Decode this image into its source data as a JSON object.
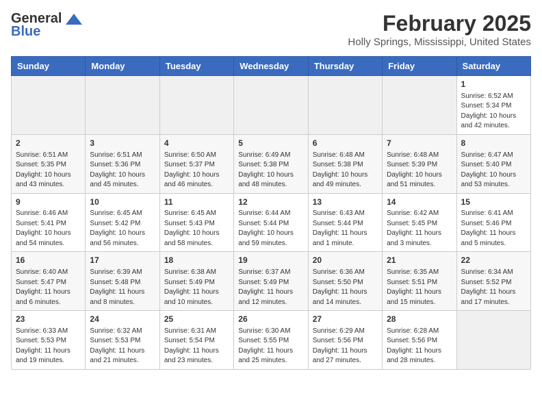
{
  "header": {
    "logo_line1": "General",
    "logo_line2": "Blue",
    "month_year": "February 2025",
    "location": "Holly Springs, Mississippi, United States"
  },
  "weekdays": [
    "Sunday",
    "Monday",
    "Tuesday",
    "Wednesday",
    "Thursday",
    "Friday",
    "Saturday"
  ],
  "weeks": [
    [
      {
        "day": "",
        "info": ""
      },
      {
        "day": "",
        "info": ""
      },
      {
        "day": "",
        "info": ""
      },
      {
        "day": "",
        "info": ""
      },
      {
        "day": "",
        "info": ""
      },
      {
        "day": "",
        "info": ""
      },
      {
        "day": "1",
        "info": "Sunrise: 6:52 AM\nSunset: 5:34 PM\nDaylight: 10 hours and 42 minutes."
      }
    ],
    [
      {
        "day": "2",
        "info": "Sunrise: 6:51 AM\nSunset: 5:35 PM\nDaylight: 10 hours and 43 minutes."
      },
      {
        "day": "3",
        "info": "Sunrise: 6:51 AM\nSunset: 5:36 PM\nDaylight: 10 hours and 45 minutes."
      },
      {
        "day": "4",
        "info": "Sunrise: 6:50 AM\nSunset: 5:37 PM\nDaylight: 10 hours and 46 minutes."
      },
      {
        "day": "5",
        "info": "Sunrise: 6:49 AM\nSunset: 5:38 PM\nDaylight: 10 hours and 48 minutes."
      },
      {
        "day": "6",
        "info": "Sunrise: 6:48 AM\nSunset: 5:38 PM\nDaylight: 10 hours and 49 minutes."
      },
      {
        "day": "7",
        "info": "Sunrise: 6:48 AM\nSunset: 5:39 PM\nDaylight: 10 hours and 51 minutes."
      },
      {
        "day": "8",
        "info": "Sunrise: 6:47 AM\nSunset: 5:40 PM\nDaylight: 10 hours and 53 minutes."
      }
    ],
    [
      {
        "day": "9",
        "info": "Sunrise: 6:46 AM\nSunset: 5:41 PM\nDaylight: 10 hours and 54 minutes."
      },
      {
        "day": "10",
        "info": "Sunrise: 6:45 AM\nSunset: 5:42 PM\nDaylight: 10 hours and 56 minutes."
      },
      {
        "day": "11",
        "info": "Sunrise: 6:45 AM\nSunset: 5:43 PM\nDaylight: 10 hours and 58 minutes."
      },
      {
        "day": "12",
        "info": "Sunrise: 6:44 AM\nSunset: 5:44 PM\nDaylight: 10 hours and 59 minutes."
      },
      {
        "day": "13",
        "info": "Sunrise: 6:43 AM\nSunset: 5:44 PM\nDaylight: 11 hours and 1 minute."
      },
      {
        "day": "14",
        "info": "Sunrise: 6:42 AM\nSunset: 5:45 PM\nDaylight: 11 hours and 3 minutes."
      },
      {
        "day": "15",
        "info": "Sunrise: 6:41 AM\nSunset: 5:46 PM\nDaylight: 11 hours and 5 minutes."
      }
    ],
    [
      {
        "day": "16",
        "info": "Sunrise: 6:40 AM\nSunset: 5:47 PM\nDaylight: 11 hours and 6 minutes."
      },
      {
        "day": "17",
        "info": "Sunrise: 6:39 AM\nSunset: 5:48 PM\nDaylight: 11 hours and 8 minutes."
      },
      {
        "day": "18",
        "info": "Sunrise: 6:38 AM\nSunset: 5:49 PM\nDaylight: 11 hours and 10 minutes."
      },
      {
        "day": "19",
        "info": "Sunrise: 6:37 AM\nSunset: 5:49 PM\nDaylight: 11 hours and 12 minutes."
      },
      {
        "day": "20",
        "info": "Sunrise: 6:36 AM\nSunset: 5:50 PM\nDaylight: 11 hours and 14 minutes."
      },
      {
        "day": "21",
        "info": "Sunrise: 6:35 AM\nSunset: 5:51 PM\nDaylight: 11 hours and 15 minutes."
      },
      {
        "day": "22",
        "info": "Sunrise: 6:34 AM\nSunset: 5:52 PM\nDaylight: 11 hours and 17 minutes."
      }
    ],
    [
      {
        "day": "23",
        "info": "Sunrise: 6:33 AM\nSunset: 5:53 PM\nDaylight: 11 hours and 19 minutes."
      },
      {
        "day": "24",
        "info": "Sunrise: 6:32 AM\nSunset: 5:53 PM\nDaylight: 11 hours and 21 minutes."
      },
      {
        "day": "25",
        "info": "Sunrise: 6:31 AM\nSunset: 5:54 PM\nDaylight: 11 hours and 23 minutes."
      },
      {
        "day": "26",
        "info": "Sunrise: 6:30 AM\nSunset: 5:55 PM\nDaylight: 11 hours and 25 minutes."
      },
      {
        "day": "27",
        "info": "Sunrise: 6:29 AM\nSunset: 5:56 PM\nDaylight: 11 hours and 27 minutes."
      },
      {
        "day": "28",
        "info": "Sunrise: 6:28 AM\nSunset: 5:56 PM\nDaylight: 11 hours and 28 minutes."
      },
      {
        "day": "",
        "info": ""
      }
    ]
  ]
}
